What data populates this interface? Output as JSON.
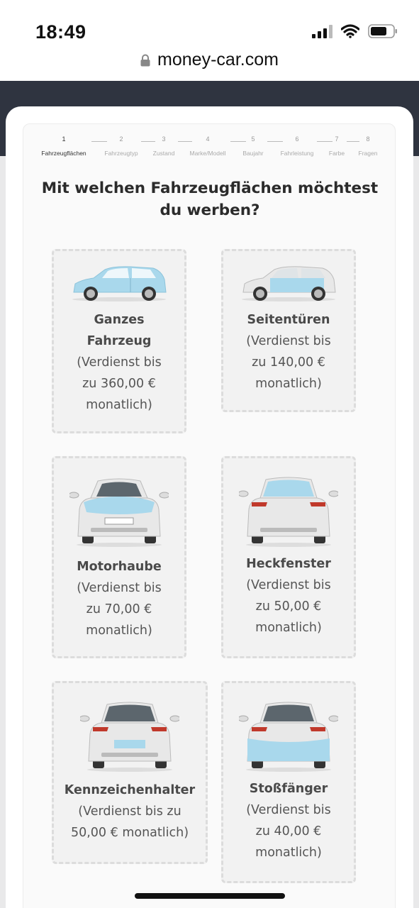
{
  "status_bar": {
    "time": "18:49"
  },
  "browser": {
    "url": "money-car.com"
  },
  "stepper": [
    {
      "num": "1",
      "label": "Fahrzeugflächen",
      "active": true
    },
    {
      "num": "2",
      "label": "Fahrzeugtyp"
    },
    {
      "num": "3",
      "label": "Zustand"
    },
    {
      "num": "4",
      "label": "Marke/Modell"
    },
    {
      "num": "5",
      "label": "Baujahr"
    },
    {
      "num": "6",
      "label": "Fahrleistung"
    },
    {
      "num": "7",
      "label": "Farbe"
    },
    {
      "num": "8",
      "label": "Fragen"
    }
  ],
  "question": {
    "line1": "Mit welchen Fahrzeugflächen möchtest",
    "line2": "du werben?"
  },
  "options": [
    {
      "title1": "Ganzes",
      "title2": "Fahrzeug",
      "d1": "(Verdienst bis",
      "d2": "zu 360,00 €",
      "d3": "monatlich)",
      "icon": "car-side-full-icon"
    },
    {
      "title1": "Seitentüren",
      "d1": "(Verdienst bis",
      "d2": "zu 140,00 €",
      "d3": "monatlich)",
      "icon": "car-side-doors-icon"
    },
    {
      "title1": "Motorhaube",
      "d1": "(Verdienst bis",
      "d2": "zu 70,00 €",
      "d3": "monatlich)",
      "icon": "car-front-hood-icon"
    },
    {
      "title1": "Heckfenster",
      "d1": "(Verdienst bis",
      "d2": "zu 50,00 €",
      "d3": "monatlich)",
      "icon": "car-rear-window-icon"
    },
    {
      "title1": "Kennzeichenhalter",
      "d1": "(Verdienst bis zu",
      "d2": "50,00 € monatlich)",
      "icon": "car-rear-plate-icon"
    },
    {
      "title1": "Stoßfänger",
      "d1": "(Verdienst bis",
      "d2": "zu 40,00 €",
      "d3": "monatlich)",
      "icon": "car-rear-bumper-icon"
    }
  ],
  "colors": {
    "highlight": "#a9d8ec",
    "car_body": "#e6e6e6",
    "tile_bg": "#f2f2f2",
    "dark_band": "#2f3440"
  }
}
